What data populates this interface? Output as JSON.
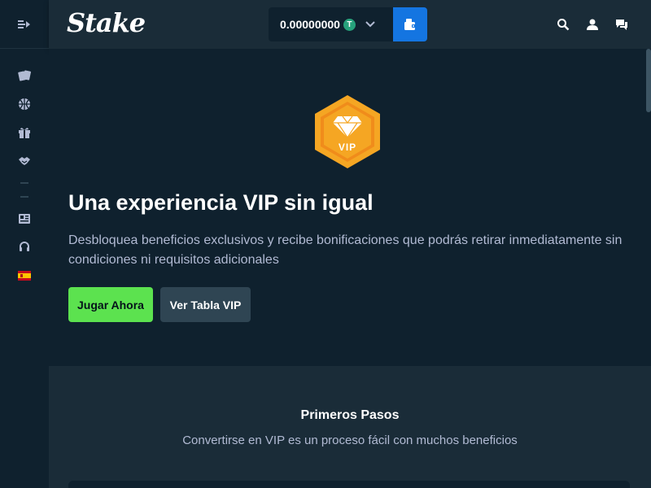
{
  "sidebar": {
    "toggle_icon": "collapse-arrow-icon",
    "items": [
      {
        "name": "casino",
        "icon": "cards-icon"
      },
      {
        "name": "sports",
        "icon": "basketball-icon"
      },
      {
        "name": "promotions",
        "icon": "gift-icon"
      },
      {
        "name": "affiliate",
        "icon": "handshake-icon"
      },
      {
        "name": "blog",
        "icon": "newspaper-icon"
      },
      {
        "name": "support",
        "icon": "headset-icon"
      },
      {
        "name": "language",
        "icon": "spain-flag-icon"
      }
    ]
  },
  "header": {
    "logo": "Stake",
    "balance": "0.00000000",
    "currency_symbol": "T",
    "wallet_icon": "wallet-icon",
    "icons": [
      "search-icon",
      "user-icon",
      "chat-icon"
    ]
  },
  "hero": {
    "badge_text": "VIP",
    "title": "Una experiencia VIP sin igual",
    "description": "Desbloquea beneficios exclusivos y recibe bonificaciones que podrás retirar inmediatamente sin condiciones ni requisitos adicionales",
    "play_button": "Jugar Ahora",
    "table_button": "Ver Tabla VIP"
  },
  "steps": {
    "title": "Primeros Pasos",
    "subtitle": "Convertirse en VIP es un proceso fácil con muchos beneficios"
  },
  "colors": {
    "background": "#1a2c38",
    "panel": "#0f212e",
    "accent_green": "#5ce24f",
    "accent_blue": "#1475e1",
    "muted_text": "#b1bad3",
    "badge_gold": "#f5a623",
    "tether_green": "#26a17b"
  }
}
